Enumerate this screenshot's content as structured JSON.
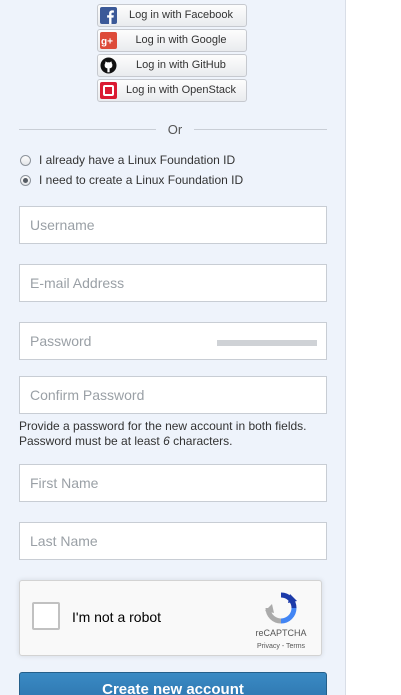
{
  "social_logins": [
    {
      "label": "Log in with Facebook",
      "icon": "facebook-icon",
      "color": "#3b5998"
    },
    {
      "label": "Log in with Google",
      "icon": "google-plus-icon",
      "color": "#dd4b39"
    },
    {
      "label": "Log in with GitHub",
      "icon": "github-icon",
      "color": "#000000"
    },
    {
      "label": "Log in with OpenStack",
      "icon": "openstack-icon",
      "color": "#da1a32"
    }
  ],
  "divider": {
    "text": "Or"
  },
  "account_options": [
    {
      "label": "I already have a Linux Foundation ID",
      "selected": false
    },
    {
      "label": "I need to create a Linux Foundation ID",
      "selected": true
    }
  ],
  "form": {
    "username_placeholder": "Username",
    "username_value": "",
    "email_placeholder": "E-mail Address",
    "email_value": "",
    "password_placeholder": "Password",
    "password_value": "",
    "confirm_password_placeholder": "Confirm Password",
    "confirm_password_value": "",
    "password_help_prefix": "Provide a password for the new account in both fields. Password must be at least ",
    "password_help_number": "6",
    "password_help_suffix": " characters.",
    "first_name_placeholder": "First Name",
    "first_name_value": "",
    "last_name_placeholder": "Last Name",
    "last_name_value": ""
  },
  "captcha": {
    "label": "I'm not a robot",
    "brand": "reCAPTCHA",
    "links": "Privacy - Terms",
    "checked": false
  },
  "submit": {
    "label": "Create new account"
  },
  "colors": {
    "panel_background": "#eef3fb",
    "submit_background": "#2f7cb8"
  }
}
